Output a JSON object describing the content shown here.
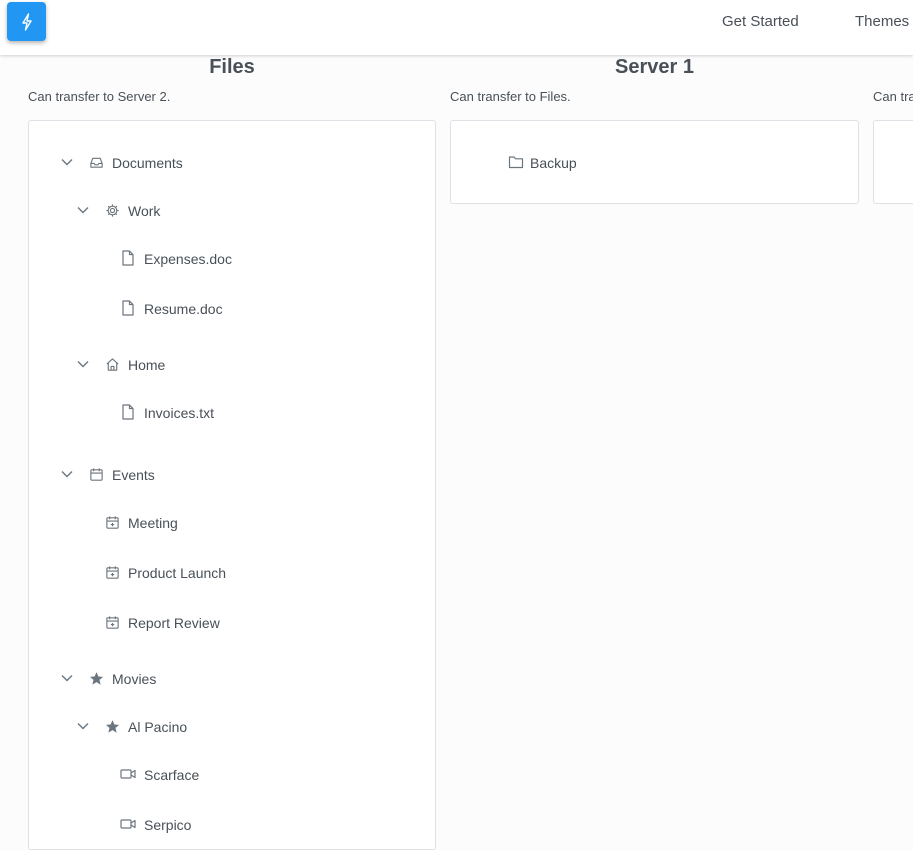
{
  "header": {
    "logo_icon": "lightning-icon",
    "nav": [
      "Get Started",
      "Themes"
    ]
  },
  "columns": [
    {
      "title": "Files",
      "subtitle": "Can transfer to Server 2."
    },
    {
      "title": "Server 1",
      "subtitle": "Can transfer to Files."
    },
    {
      "title": "",
      "subtitle": "Can tra"
    }
  ],
  "tree_files": [
    {
      "label": "Documents",
      "icon": "inbox-icon",
      "expanded": true
    },
    {
      "label": "Work",
      "icon": "cog-icon",
      "expanded": true
    },
    {
      "label": "Expenses.doc",
      "icon": "file-icon"
    },
    {
      "label": "Resume.doc",
      "icon": "file-icon"
    },
    {
      "label": "Home",
      "icon": "home-icon",
      "expanded": true
    },
    {
      "label": "Invoices.txt",
      "icon": "file-icon"
    },
    {
      "label": "Events",
      "icon": "calendar-icon",
      "expanded": true
    },
    {
      "label": "Meeting",
      "icon": "calendar-plus-icon"
    },
    {
      "label": "Product Launch",
      "icon": "calendar-plus-icon"
    },
    {
      "label": "Report Review",
      "icon": "calendar-plus-icon"
    },
    {
      "label": "Movies",
      "icon": "star-icon",
      "expanded": true
    },
    {
      "label": "Al Pacino",
      "icon": "star-icon",
      "expanded": true
    },
    {
      "label": "Scarface",
      "icon": "video-icon"
    },
    {
      "label": "Serpico",
      "icon": "video-icon"
    }
  ],
  "tree_server1": [
    {
      "label": "Backup",
      "icon": "folder-icon"
    }
  ]
}
